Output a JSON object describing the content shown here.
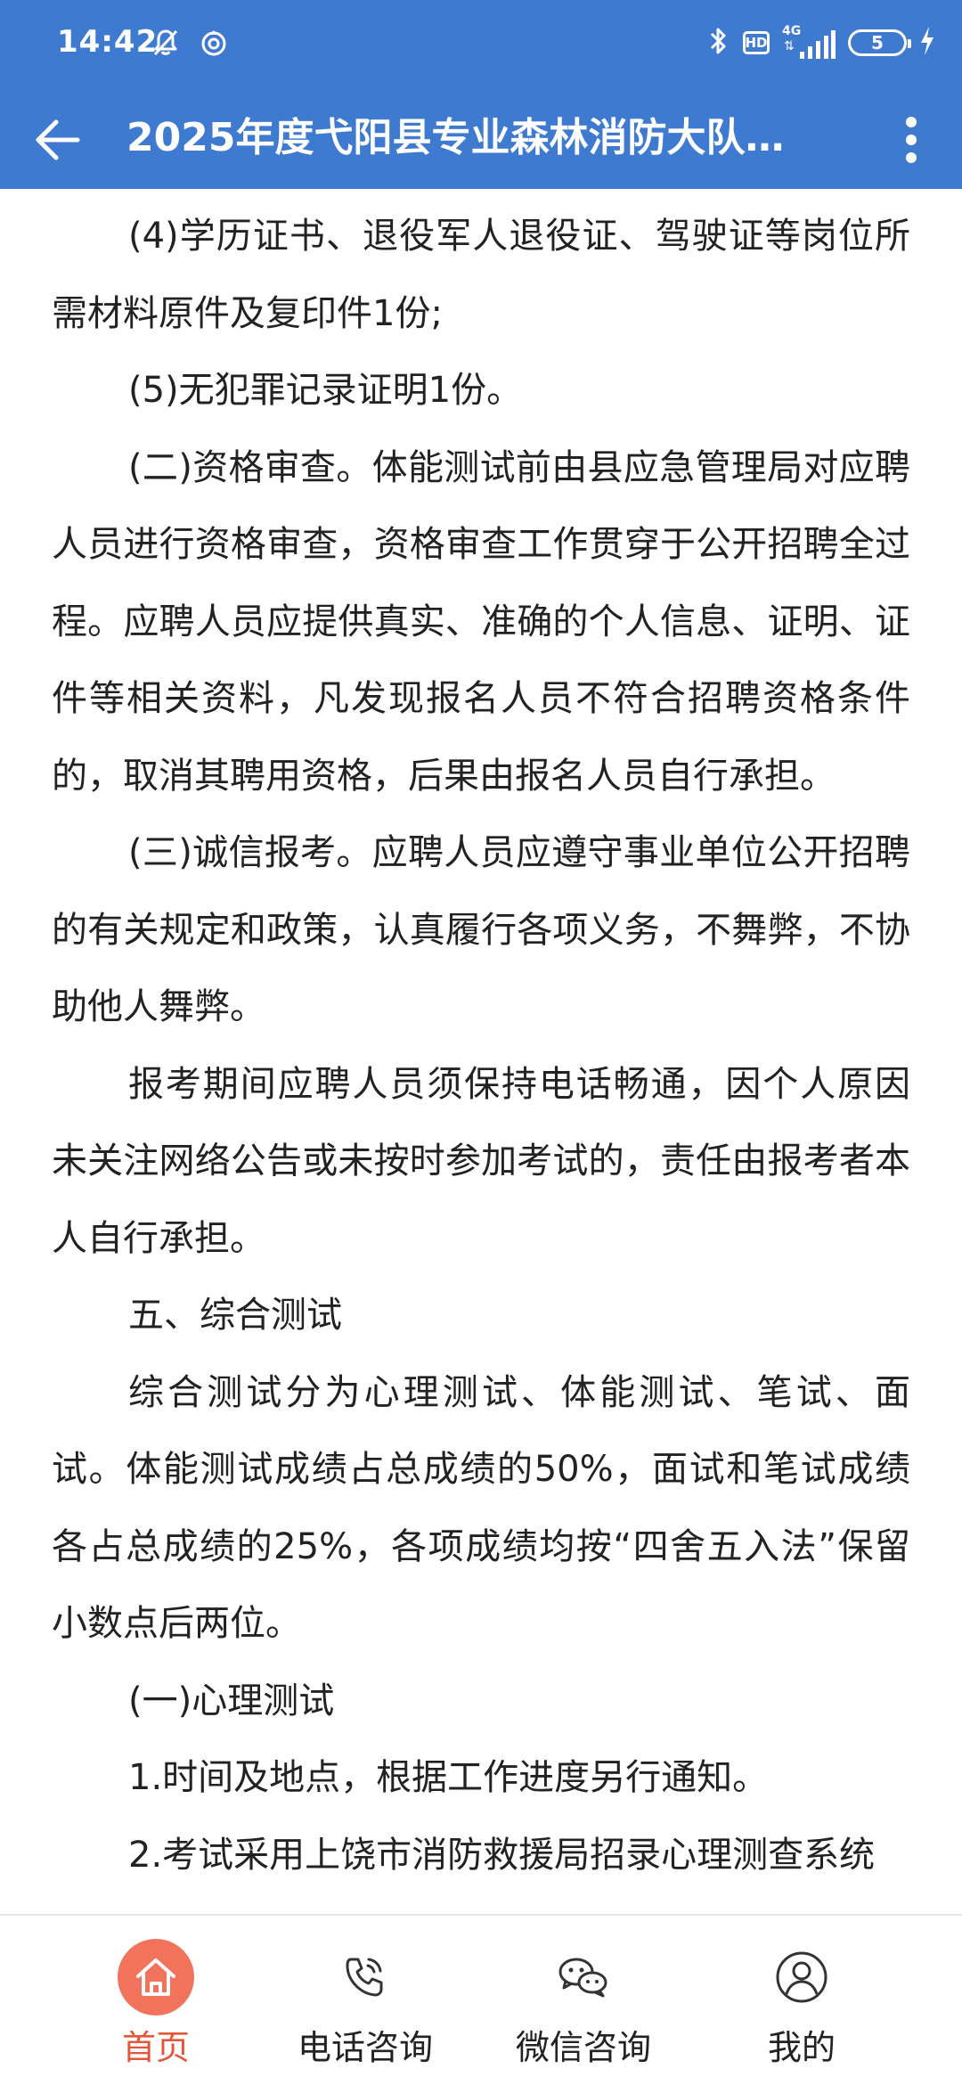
{
  "status_bar": {
    "time": "14:42",
    "hd_label": "HD",
    "network_label": "4G",
    "battery_level": "5",
    "icons": [
      "bell-mute-icon",
      "hotspot-icon",
      "bluetooth-icon",
      "hd-icon",
      "signal-icon",
      "battery-icon",
      "charging-icon"
    ]
  },
  "header": {
    "title": "2025年度弋阳县专业森林消防大队…",
    "accent_color": "#3f7ad1"
  },
  "content": {
    "paragraphs": [
      {
        "text": "(4)学历证书、退役军人退役证、驾驶证等岗位所需材料原件及复印件1份;"
      },
      {
        "text": "(5)无犯罪记录证明1份。"
      },
      {
        "text": "(二)资格审查。体能测试前由县应急管理局对应聘人员进行资格审查，资格审查工作贯穿于公开招聘全过程。应聘人员应提供真实、准确的个人信息、证明、证件等相关资料，凡发现报名人员不符合招聘资格条件的，取消其聘用资格，后果由报名人员自行承担。"
      },
      {
        "text": "(三)诚信报考。应聘人员应遵守事业单位公开招聘的有关规定和政策，认真履行各项义务，不舞弊，不协助他人舞弊。"
      },
      {
        "text": "报考期间应聘人员须保持电话畅通，因个人原因未关注网络公告或未按时参加考试的，责任由报考者本人自行承担。"
      },
      {
        "text": "五、综合测试"
      },
      {
        "text": "综合测试分为心理测试、体能测试、笔试、面试。体能测试成绩占总成绩的50%，面试和笔试成绩各占总成绩的25%，各项成绩均按“四舍五入法”保留小数点后两位。"
      },
      {
        "text": "(一)心理测试"
      },
      {
        "text": "1.时间及地点，根据工作进度另行通知。"
      },
      {
        "text": "2.考试采用上饶市消防救援局招录心理测查系统"
      }
    ]
  },
  "bottom_nav": {
    "active_color": "#e45638",
    "items": [
      {
        "label": "首页",
        "icon": "home-icon",
        "active": true
      },
      {
        "label": "电话咨询",
        "icon": "phone-icon",
        "active": false
      },
      {
        "label": "微信咨询",
        "icon": "wechat-icon",
        "active": false
      },
      {
        "label": "我的",
        "icon": "user-icon",
        "active": false
      }
    ]
  }
}
